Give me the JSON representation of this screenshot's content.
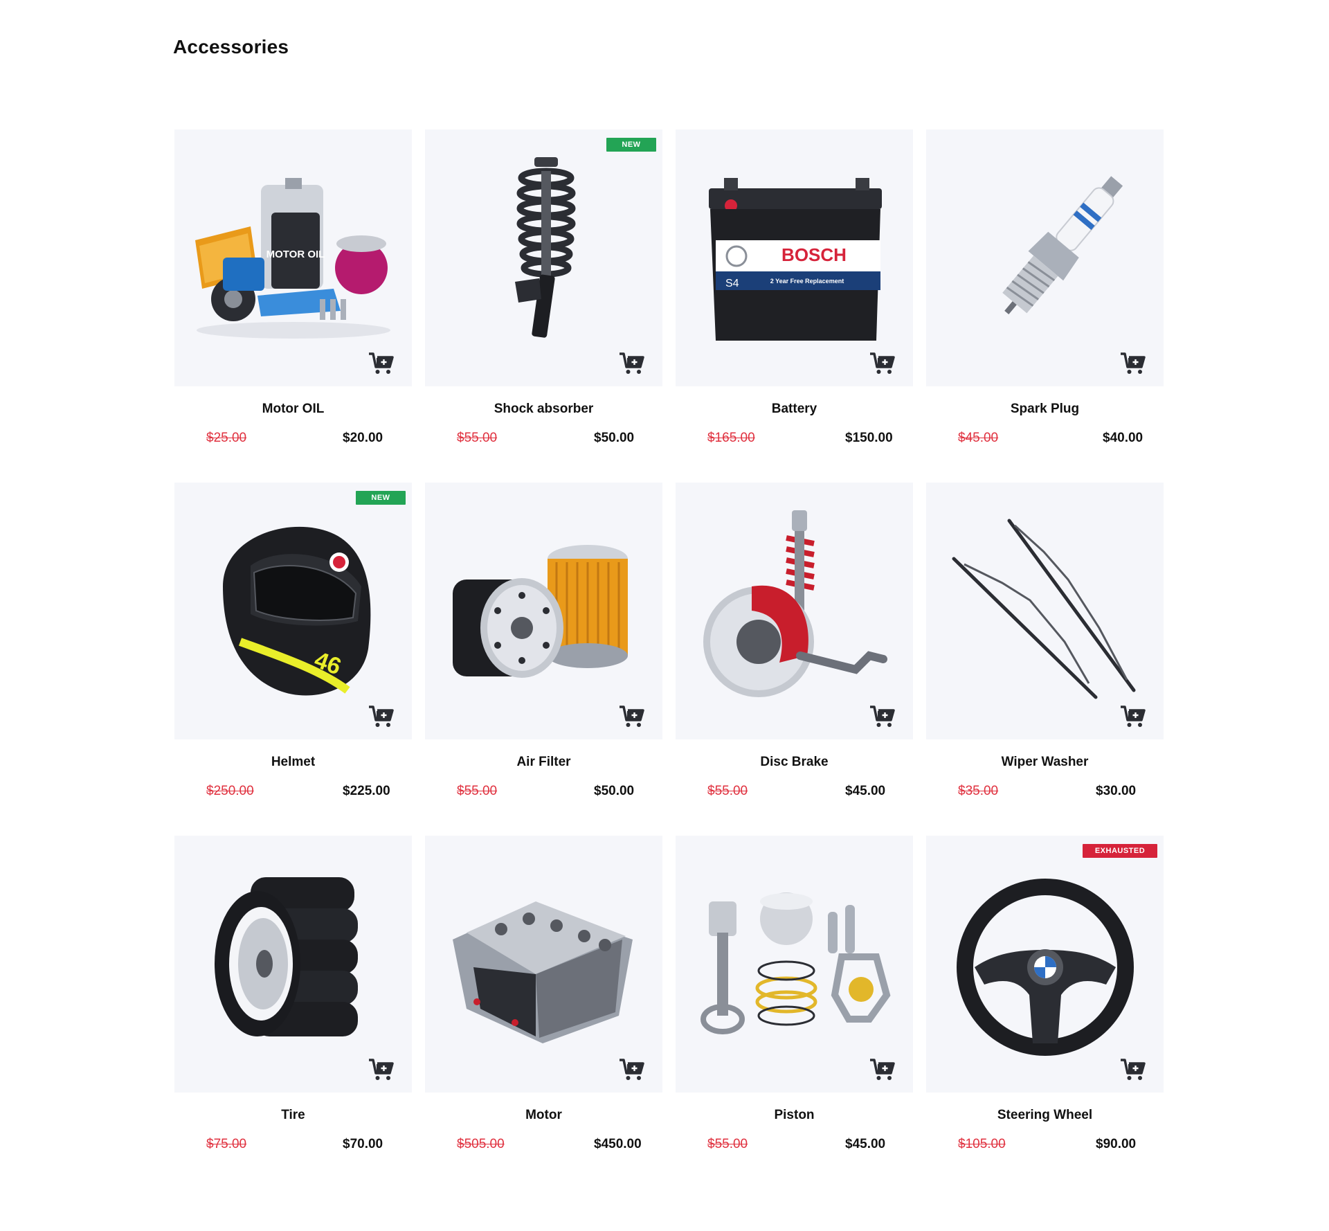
{
  "page": {
    "title": "Accessories"
  },
  "colors": {
    "tile_bg": "#f5f6fa",
    "badge_new": "#23a455",
    "badge_exhausted": "#d6233a",
    "old_price": "#e0313f",
    "cart_icon": "#2b2d33"
  },
  "products": [
    {
      "name": "Motor OIL",
      "old_price": "$25.00",
      "price": "$20.00",
      "badge": null,
      "icon": "motor-oil-kit-image",
      "art_text": "MOTOR OIL"
    },
    {
      "name": "Shock absorber",
      "old_price": "$55.00",
      "price": "$50.00",
      "badge": "NEW",
      "icon": "shock-absorber-image"
    },
    {
      "name": "Battery",
      "old_price": "$165.00",
      "price": "$150.00",
      "badge": null,
      "icon": "battery-image",
      "art_text": "BOSCH",
      "art_sub": "S4",
      "art_sub2": "2 Year Free Replacement"
    },
    {
      "name": "Spark Plug",
      "old_price": "$45.00",
      "price": "$40.00",
      "badge": null,
      "icon": "spark-plug-image"
    },
    {
      "name": "Helmet",
      "old_price": "$250.00",
      "price": "$225.00",
      "badge": "NEW",
      "icon": "helmet-image"
    },
    {
      "name": "Air Filter",
      "old_price": "$55.00",
      "price": "$50.00",
      "badge": null,
      "icon": "oil-filter-image"
    },
    {
      "name": "Disc Brake",
      "old_price": "$55.00",
      "price": "$45.00",
      "badge": null,
      "icon": "disc-brake-image"
    },
    {
      "name": "Wiper Washer",
      "old_price": "$35.00",
      "price": "$30.00",
      "badge": null,
      "icon": "wiper-blades-image"
    },
    {
      "name": "Tire",
      "old_price": "$75.00",
      "price": "$70.00",
      "badge": null,
      "icon": "tire-stack-image"
    },
    {
      "name": "Motor",
      "old_price": "$505.00",
      "price": "$450.00",
      "badge": null,
      "icon": "engine-image"
    },
    {
      "name": "Piston",
      "old_price": "$55.00",
      "price": "$45.00",
      "badge": null,
      "icon": "piston-kit-image"
    },
    {
      "name": "Steering Wheel",
      "old_price": "$105.00",
      "price": "$90.00",
      "badge": "EXHAUSTED",
      "icon": "steering-wheel-image"
    }
  ]
}
